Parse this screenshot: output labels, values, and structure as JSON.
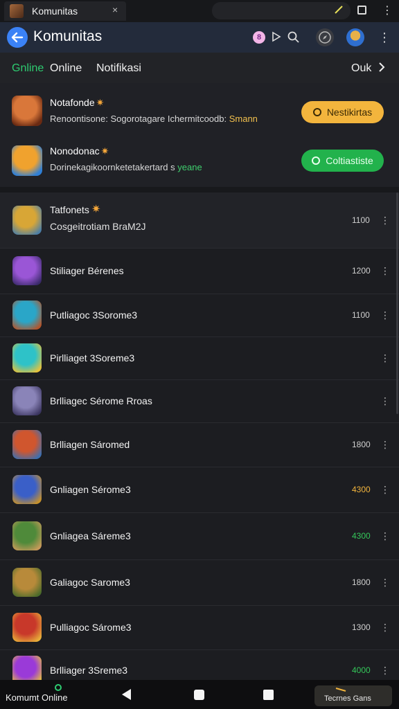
{
  "browser": {
    "tab_title": "Komunitas",
    "tab_close": "×",
    "menu_icon": "more-vert-icon"
  },
  "header": {
    "title": "Komunitas",
    "badge": "8"
  },
  "filters": {
    "items": [
      "Gnline",
      "Online",
      "Notifikasi"
    ],
    "right_label": "Ouk"
  },
  "featured": [
    {
      "name": "Notafonde",
      "sub_main": "Renoontisone: Sogorotagare Ichermitcoodb: ",
      "sub_highlight": "Smann",
      "button": "Nestikirtas",
      "button_color": "#f3b53d",
      "icon_colors": [
        "#d9773a",
        "#6a2a12"
      ]
    },
    {
      "name": "Nonodonac",
      "sub_main": "Dorinekagikoornketetakertard s ",
      "sub_highlight": "yeane",
      "button": "Coltiastiste",
      "button_color": "#22b24c",
      "icon_colors": [
        "#f0a22e",
        "#2f7fd6"
      ]
    }
  ],
  "rows": [
    {
      "title": "Tatfonets",
      "sub": "Cosgeitrotiam BraM2J",
      "count": "1100",
      "count_color": "default",
      "icon_colors": [
        "#d8a636",
        "#4a7ea8"
      ]
    },
    {
      "title": "Stiliager Bérenes",
      "sub": "",
      "count": "1200",
      "count_color": "default",
      "icon_colors": [
        "#9a56d6",
        "#3a2a6a"
      ]
    },
    {
      "title": "Putliagoc 3Sorome3",
      "sub": "",
      "count": "1100",
      "count_color": "default",
      "icon_colors": [
        "#2aa6c8",
        "#b4542a"
      ]
    },
    {
      "title": "Pirlliaget 3Soreme3",
      "sub": "",
      "count": "",
      "count_color": "default",
      "icon_colors": [
        "#2ec2c8",
        "#e8c23a"
      ]
    },
    {
      "title": "Brlliagec Sérome Rroas",
      "sub": "",
      "count": "",
      "count_color": "default",
      "icon_colors": [
        "#8a84b8",
        "#3b3560"
      ]
    },
    {
      "title": "Brlliagen Sáromed",
      "sub": "",
      "count": "1800",
      "count_color": "default",
      "icon_colors": [
        "#d0562e",
        "#3b6fb0"
      ]
    },
    {
      "title": "Gnliagen Sérome3",
      "sub": "",
      "count": "4300",
      "count_color": "yellow",
      "icon_colors": [
        "#3a5fc8",
        "#c8922a"
      ]
    },
    {
      "title": "Gnliagea Sáreme3",
      "sub": "",
      "count": "4300",
      "count_color": "green",
      "icon_colors": [
        "#4f8a3a",
        "#c89a5a"
      ]
    },
    {
      "title": "Galiagoc Sarome3",
      "sub": "",
      "count": "1800",
      "count_color": "default",
      "icon_colors": [
        "#b88a3a",
        "#4a6a2a"
      ]
    },
    {
      "title": "Pulliagoc Sárome3",
      "sub": "",
      "count": "1300",
      "count_color": "default",
      "icon_colors": [
        "#c8382a",
        "#e8b03a"
      ]
    },
    {
      "title": "Brlliager 3Sreme3",
      "sub": "",
      "count": "4000",
      "count_color": "green",
      "icon_colors": [
        "#9a3ad8",
        "#e8c23a"
      ]
    }
  ],
  "bottom": {
    "label": "Komumt Online",
    "pill_label": "Tecrnes Gans"
  },
  "colors": {
    "accent_green": "#2ecc71",
    "accent_blue": "#3b82f6",
    "background": "#1c1d21"
  }
}
